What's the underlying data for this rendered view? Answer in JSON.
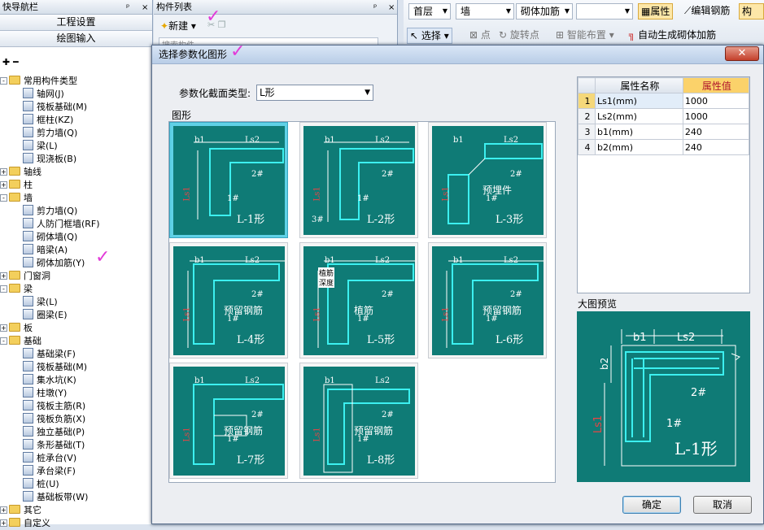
{
  "nav": {
    "title": "快导航栏",
    "pin": "ᵖ",
    "close": "×",
    "btn_settings": "工程设置",
    "btn_drawing": "绘图输入",
    "tree": [
      {
        "label": "常用构件类型",
        "level": 0,
        "type": "folder",
        "exp": "-"
      },
      {
        "label": "轴网(J)",
        "level": 1,
        "type": "item"
      },
      {
        "label": "筏板基础(M)",
        "level": 1,
        "type": "item"
      },
      {
        "label": "框柱(KZ)",
        "level": 1,
        "type": "item"
      },
      {
        "label": "剪力墙(Q)",
        "level": 1,
        "type": "item"
      },
      {
        "label": "梁(L)",
        "level": 1,
        "type": "item"
      },
      {
        "label": "现浇板(B)",
        "level": 1,
        "type": "item"
      },
      {
        "label": "轴线",
        "level": 0,
        "type": "folder",
        "exp": "+"
      },
      {
        "label": "柱",
        "level": 0,
        "type": "folder",
        "exp": "+"
      },
      {
        "label": "墙",
        "level": 0,
        "type": "folder",
        "exp": "-"
      },
      {
        "label": "剪力墙(Q)",
        "level": 1,
        "type": "item"
      },
      {
        "label": "人防门框墙(RF)",
        "level": 1,
        "type": "item"
      },
      {
        "label": "砌体墙(Q)",
        "level": 1,
        "type": "item"
      },
      {
        "label": "暗梁(A)",
        "level": 1,
        "type": "item"
      },
      {
        "label": "砌体加筋(Y)",
        "level": 1,
        "type": "item"
      },
      {
        "label": "门窗洞",
        "level": 0,
        "type": "folder",
        "exp": "+"
      },
      {
        "label": "梁",
        "level": 0,
        "type": "folder",
        "exp": "-"
      },
      {
        "label": "梁(L)",
        "level": 1,
        "type": "item"
      },
      {
        "label": "圈梁(E)",
        "level": 1,
        "type": "item"
      },
      {
        "label": "板",
        "level": 0,
        "type": "folder",
        "exp": "+"
      },
      {
        "label": "基础",
        "level": 0,
        "type": "folder",
        "exp": "-"
      },
      {
        "label": "基础梁(F)",
        "level": 1,
        "type": "item"
      },
      {
        "label": "筏板基础(M)",
        "level": 1,
        "type": "item"
      },
      {
        "label": "集水坑(K)",
        "level": 1,
        "type": "item"
      },
      {
        "label": "柱墩(Y)",
        "level": 1,
        "type": "item"
      },
      {
        "label": "筏板主筋(R)",
        "level": 1,
        "type": "item"
      },
      {
        "label": "筏板负筋(X)",
        "level": 1,
        "type": "item"
      },
      {
        "label": "独立基础(P)",
        "level": 1,
        "type": "item"
      },
      {
        "label": "条形基础(T)",
        "level": 1,
        "type": "item"
      },
      {
        "label": "桩承台(V)",
        "level": 1,
        "type": "item"
      },
      {
        "label": "承台梁(F)",
        "level": 1,
        "type": "item"
      },
      {
        "label": "桩(U)",
        "level": 1,
        "type": "item"
      },
      {
        "label": "基础板带(W)",
        "level": 1,
        "type": "item"
      },
      {
        "label": "其它",
        "level": 0,
        "type": "folder",
        "exp": "+"
      },
      {
        "label": "自定义",
        "level": 0,
        "type": "folder",
        "exp": "+"
      }
    ]
  },
  "components": {
    "title": "构件列表",
    "new_btn": "新建",
    "search": "搜索构件..."
  },
  "toolbar": {
    "floor": "首层",
    "category": "墙",
    "type": "砌体加筋",
    "prop_btn": "属性",
    "edit_rebar": "编辑钢筋",
    "more": "构",
    "select": "选择",
    "point": "点",
    "rotate_point": "旋转点",
    "smart": "智能布置",
    "auto_gen": "自动生成砌体加筋"
  },
  "dialog": {
    "title": "选择参数化图形",
    "close": "✕",
    "section_type_label": "参数化截面类型:",
    "section_type_value": "L形",
    "shapes_label": "图形",
    "preview_label": "大图预览",
    "ok": "确定",
    "cancel": "取消",
    "shapes": [
      {
        "name": "L-1形",
        "sub": ""
      },
      {
        "name": "L-2形",
        "sub": ""
      },
      {
        "name": "L-3形",
        "sub": "预埋件"
      },
      {
        "name": "L-4形",
        "sub": "预留钢筋"
      },
      {
        "name": "L-5形",
        "sub": "植筋"
      },
      {
        "name": "L-6形",
        "sub": "预留钢筋"
      },
      {
        "name": "L-7形",
        "sub": "预留钢筋"
      },
      {
        "name": "L-8形",
        "sub": "预留钢筋"
      }
    ],
    "dim": {
      "b1": "b1",
      "b2": "b2",
      "ls1": "Ls1",
      "ls2": "Ls2",
      "r1": "1#",
      "r2": "2#",
      "r3": "3#",
      "zhijin": "植筋",
      "shendu": "深度"
    },
    "props": {
      "col_name": "属性名称",
      "col_value": "属性值",
      "rows": [
        {
          "n": "1",
          "name": "Ls1(mm)",
          "value": "1000"
        },
        {
          "n": "2",
          "name": "Ls2(mm)",
          "value": "1000"
        },
        {
          "n": "3",
          "name": "b1(mm)",
          "value": "240"
        },
        {
          "n": "4",
          "name": "b2(mm)",
          "value": "240"
        }
      ]
    }
  }
}
